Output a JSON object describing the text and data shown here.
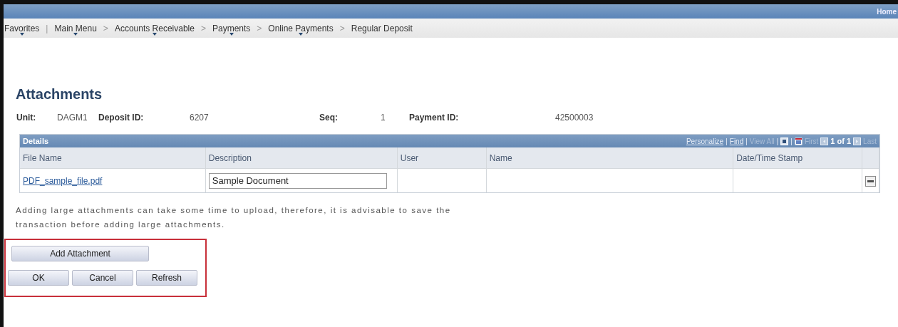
{
  "header": {
    "home_link": "Home"
  },
  "breadcrumbs": [
    {
      "label": "Favorites",
      "has_menu": true,
      "separator": "|"
    },
    {
      "label": "Main Menu",
      "has_menu": true,
      "separator": ">"
    },
    {
      "label": "Accounts Receivable",
      "has_menu": true,
      "separator": ">"
    },
    {
      "label": "Payments",
      "has_menu": true,
      "separator": ">"
    },
    {
      "label": "Online Payments",
      "has_menu": true,
      "separator": ">"
    },
    {
      "label": "Regular Deposit",
      "has_menu": false
    }
  ],
  "page_title": "Attachments",
  "fields": [
    {
      "label": "Unit:",
      "value": "DAGM1"
    },
    {
      "label": "Deposit ID:",
      "value": "6207"
    },
    {
      "label": "Seq:",
      "value": "1"
    },
    {
      "label": "Payment ID:",
      "value": "42500003"
    }
  ],
  "grid": {
    "title": "Details",
    "toolbar": [
      {
        "kind": "link",
        "text": "Personalize",
        "disabled": false
      },
      {
        "kind": "sep",
        "text": "|"
      },
      {
        "kind": "link",
        "text": "Find",
        "disabled": false
      },
      {
        "kind": "sep",
        "text": "|"
      },
      {
        "kind": "link",
        "text": "View All",
        "disabled": true
      },
      {
        "kind": "sep",
        "text": "|"
      },
      {
        "kind": "zoom"
      },
      {
        "kind": "sep",
        "text": "|"
      },
      {
        "kind": "download"
      },
      {
        "kind": "link",
        "text": "First",
        "disabled": true
      },
      {
        "kind": "prev"
      },
      {
        "kind": "count",
        "text": "1 of 1"
      },
      {
        "kind": "next"
      },
      {
        "kind": "link",
        "text": "Last",
        "disabled": true
      }
    ],
    "columns": [
      "File Name",
      "Description",
      "User",
      "Name",
      "Date/Time Stamp"
    ],
    "rows": [
      {
        "file": "PDF_sample_file.pdf",
        "description": "Sample Document"
      }
    ]
  },
  "note": "Adding large attachments can take some time to upload, therefore, it is advisable to save the transaction before adding large attachments.",
  "add_button": "Add Attachment",
  "buttons": [
    "OK",
    "Cancel",
    "Refresh"
  ]
}
